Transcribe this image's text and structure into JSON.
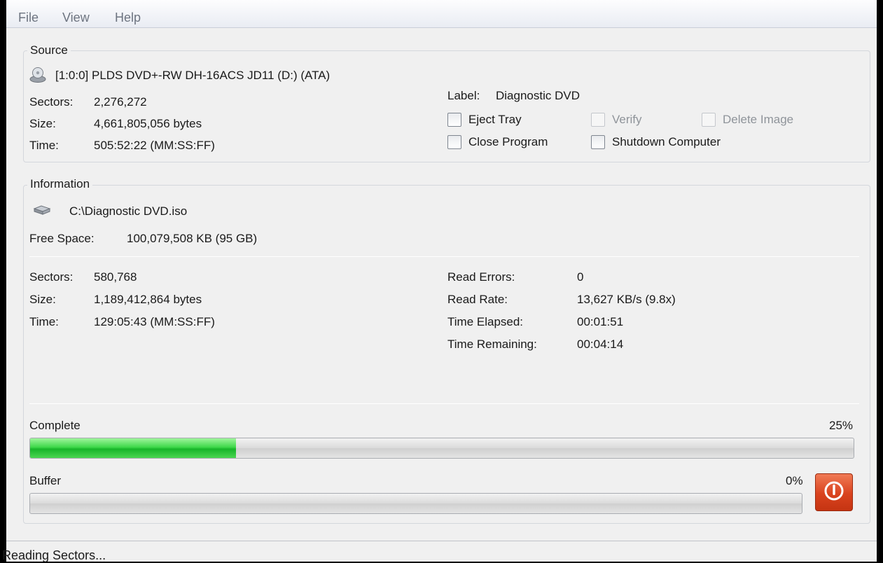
{
  "menu": {
    "file": "File",
    "view": "View",
    "help": "Help"
  },
  "source": {
    "title": "Source",
    "device": "[1:0:0] PLDS DVD+-RW DH-16ACS JD11 (D:) (ATA)",
    "sectors_label": "Sectors:",
    "sectors_value": "2,276,272",
    "size_label": "Size:",
    "size_value": "4,661,805,056 bytes",
    "time_label": "Time:",
    "time_value": "505:52:22 (MM:SS:FF)",
    "label_label": "Label:",
    "label_value": "Diagnostic DVD",
    "eject_tray": "Eject Tray",
    "verify": "Verify",
    "delete_image": "Delete Image",
    "close_program": "Close Program",
    "shutdown_computer": "Shutdown Computer"
  },
  "information": {
    "title": "Information",
    "file_path": "C:\\Diagnostic DVD.iso",
    "free_space_label": "Free Space:",
    "free_space_value": "100,079,508 KB  (95 GB)",
    "sectors_label": "Sectors:",
    "sectors_value": "580,768",
    "size_label": "Size:",
    "size_value": "1,189,412,864 bytes",
    "time_label": "Time:",
    "time_value": "129:05:43 (MM:SS:FF)",
    "read_errors_label": "Read Errors:",
    "read_errors_value": "0",
    "read_rate_label": "Read Rate:",
    "read_rate_value": "13,627 KB/s (9.8x)",
    "time_elapsed_label": "Time Elapsed:",
    "time_elapsed_value": "00:01:51",
    "time_remaining_label": "Time Remaining:",
    "time_remaining_value": "00:04:14",
    "complete_label": "Complete",
    "complete_percent": "25%",
    "complete_fraction": 0.25,
    "buffer_label": "Buffer",
    "buffer_percent": "0%",
    "buffer_fraction": 0
  },
  "status": {
    "text": "Reading Sectors..."
  },
  "colors": {
    "progress_green": "#2cc63a",
    "stop_button": "#d9431e"
  },
  "icons": {
    "drive": "optical-drive-icon",
    "hdd": "hard-disk-icon",
    "stop": "power-icon"
  }
}
